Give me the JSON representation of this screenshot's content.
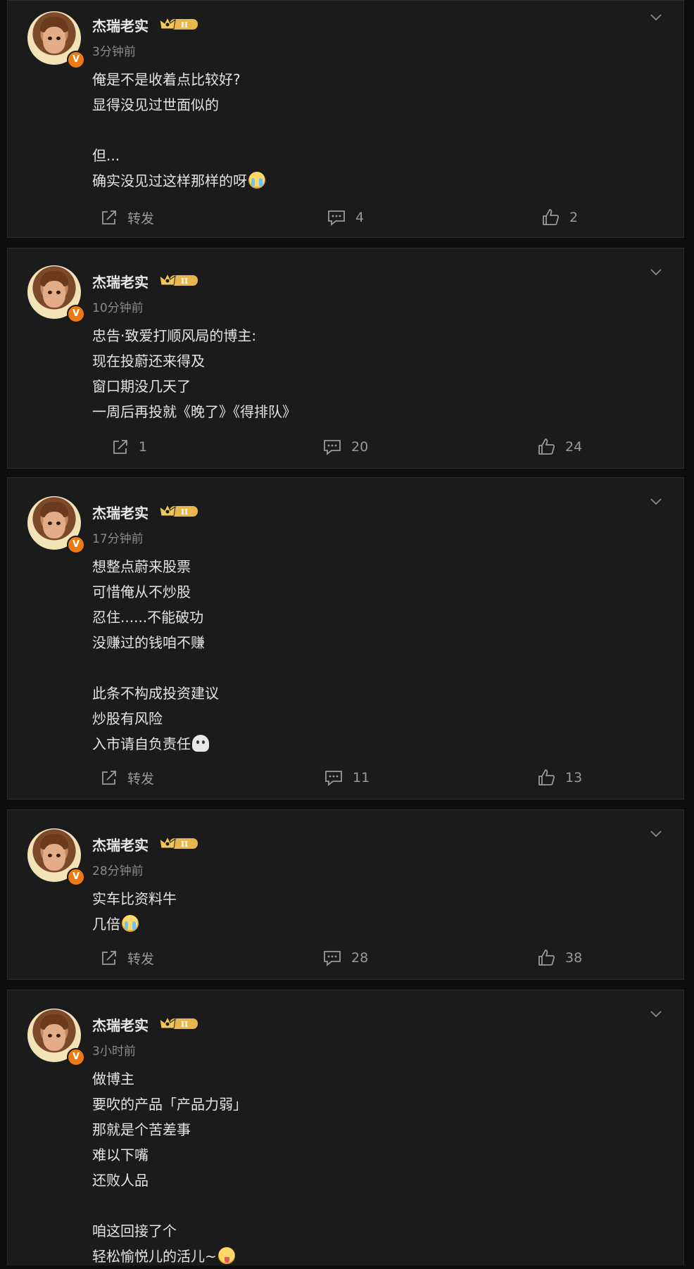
{
  "colors": {
    "background": "#0d0d0d",
    "card": "#1b1b1b",
    "verified_badge": "#f07a12",
    "crown": "#e8b64a"
  },
  "posts": [
    {
      "author": "杰瑞老实",
      "badge_icon": "crown-level-badge-icon",
      "verified_mark": "V",
      "time": "3分钟前",
      "lines": [
        "俺是不是收着点比较好?",
        "显得没见过世面似的",
        "",
        "但...",
        "确实没见过这样那样的呀"
      ],
      "line_emoji": {
        "4": "crying-emoji"
      },
      "repost": "转发",
      "comments": "4",
      "likes": "2"
    },
    {
      "author": "杰瑞老实",
      "badge_icon": "crown-level-badge-icon",
      "verified_mark": "V",
      "time": "10分钟前",
      "lines": [
        "忠告·致爱打顺风局的博主:",
        "现在投蔚还来得及",
        "窗口期没几天了",
        "一周后再投就《晚了》《得排队》"
      ],
      "repost": "1",
      "comments": "20",
      "likes": "24"
    },
    {
      "author": "杰瑞老实",
      "badge_icon": "crown-level-badge-icon",
      "verified_mark": "V",
      "time": "17分钟前",
      "lines": [
        "想整点蔚来股票",
        "可惜俺从不炒股",
        "忍住......不能破功",
        "没赚过的钱咱不赚",
        "",
        "此条不构成投资建议",
        "炒股有风险",
        "入市请自负责任"
      ],
      "line_emoji": {
        "7": "ghost-emoji"
      },
      "repost": "转发",
      "comments": "11",
      "likes": "13"
    },
    {
      "author": "杰瑞老实",
      "badge_icon": "crown-level-badge-icon",
      "verified_mark": "V",
      "time": "28分钟前",
      "lines": [
        "实车比资料牛",
        "几倍"
      ],
      "line_emoji": {
        "1": "crying-emoji"
      },
      "repost": "转发",
      "comments": "28",
      "likes": "38"
    },
    {
      "author": "杰瑞老实",
      "badge_icon": "crown-level-badge-icon",
      "verified_mark": "V",
      "time": "3小时前",
      "lines": [
        "做博主",
        "要吹的产品「产品力弱」",
        "那就是个苦差事",
        "难以下嘴",
        "还败人品",
        "",
        "咱这回接了个",
        "轻松愉悦儿的活儿~"
      ],
      "line_emoji": {
        "7": "tongue-out-emoji"
      }
    }
  ]
}
